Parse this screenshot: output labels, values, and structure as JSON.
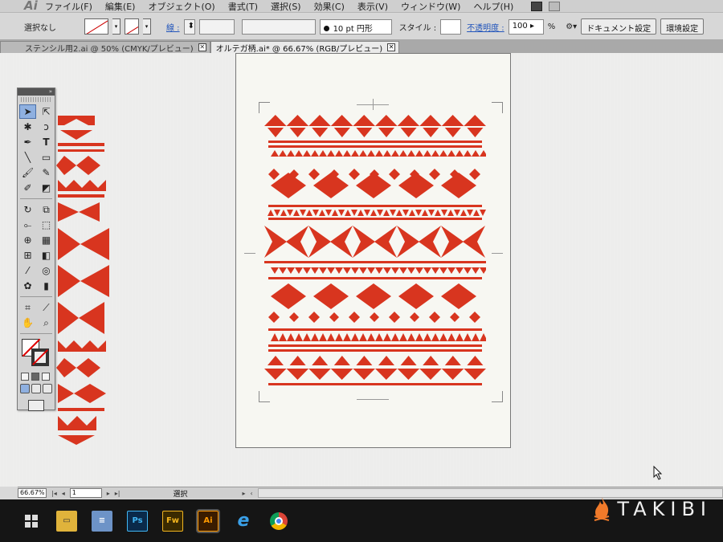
{
  "app": {
    "logo_text": "Ai"
  },
  "menu": [
    "ファイル(F)",
    "編集(E)",
    "オブジェクト(O)",
    "書式(T)",
    "選択(S)",
    "効果(C)",
    "表示(V)",
    "ウィンドウ(W)",
    "ヘルプ(H)"
  ],
  "controlbar": {
    "selection_label": "選択なし",
    "stroke_label": "線 :",
    "brush_value": "10 pt 円形",
    "style_label": "スタイル :",
    "opacity_label": "不透明度 :",
    "opacity_value": "100",
    "opacity_unit": "%",
    "document_setup_button": "ドキュメント設定",
    "preferences_button": "環境設定"
  },
  "tabs": [
    {
      "label": "ステンシル用2.ai @ 50% (CMYK/プレビュー)",
      "active": false
    },
    {
      "label": "オルテガ柄.ai* @ 66.67% (RGB/プレビュー)",
      "active": true
    }
  ],
  "tools_panel": {
    "header": "»",
    "tools": [
      "selection-tool",
      "direct-selection-tool",
      "magic-wand-tool",
      "lasso-tool",
      "pen-tool",
      "type-tool",
      "line-tool",
      "rectangle-tool",
      "paintbrush-tool",
      "pencil-tool",
      "blob-brush-tool",
      "eraser-tool",
      "rotate-tool",
      "scale-tool",
      "width-tool",
      "free-transform-tool",
      "shape-builder-tool",
      "perspective-grid-tool",
      "mesh-tool",
      "gradient-tool",
      "eyedropper-tool",
      "blend-tool",
      "symbol-sprayer-tool",
      "column-graph-tool",
      "artboard-tool",
      "slice-tool",
      "hand-tool",
      "zoom-tool"
    ]
  },
  "statusbar": {
    "zoom": "66.67%",
    "page": "1",
    "status_text": "選択"
  },
  "artwork": {
    "pattern_color": "#d8351f",
    "background_color": "#f7f7f2"
  },
  "watermark": {
    "text": "TAKIBI"
  },
  "taskbar": {
    "items": [
      "windows-start",
      "file-explorer",
      "document",
      "photoshop",
      "fireworks",
      "illustrator",
      "internet-explorer",
      "chrome"
    ],
    "ps": "Ps",
    "fw": "Fw",
    "ai": "Ai",
    "ie": "e"
  }
}
